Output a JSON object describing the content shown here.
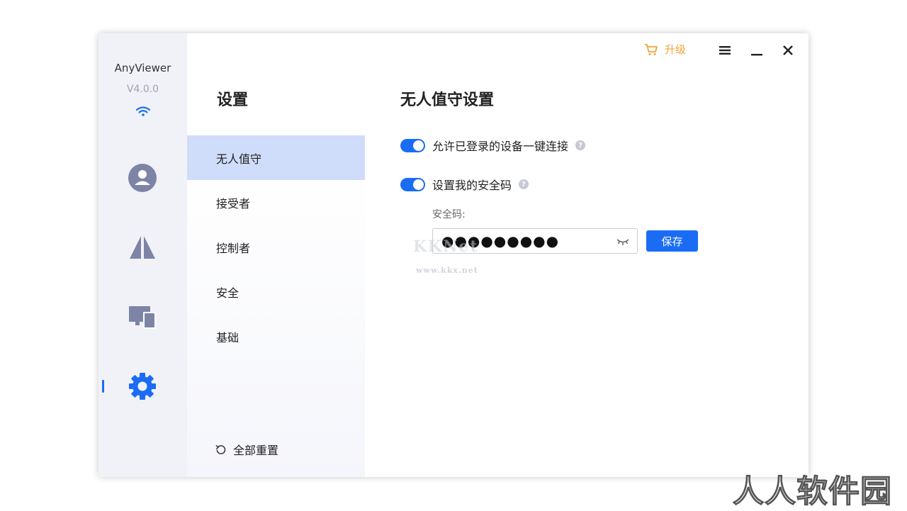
{
  "app": {
    "name": "AnyViewer",
    "version": "V4.0.0"
  },
  "rail": {
    "items": [
      {
        "icon": "account-icon"
      },
      {
        "icon": "remote-control-icon"
      },
      {
        "icon": "devices-icon"
      },
      {
        "icon": "settings-gear-icon",
        "active": true
      }
    ]
  },
  "nav": {
    "title": "设置",
    "items": [
      {
        "label": "无人值守",
        "active": true
      },
      {
        "label": "接受者"
      },
      {
        "label": "控制者"
      },
      {
        "label": "安全"
      },
      {
        "label": "基础"
      }
    ],
    "reset_label": "全部重置"
  },
  "topbar": {
    "upgrade_label": "升级"
  },
  "main": {
    "title": "无人值守设置",
    "toggle1_label": "允许已登录的设备一键连接",
    "toggle1_on": true,
    "toggle2_label": "设置我的安全码",
    "toggle2_on": true,
    "code_label": "安全码:",
    "code_value": "●●●●●●●●●",
    "save_label": "保存"
  },
  "watermarks": {
    "kk": "KKNet",
    "url": "www.kkx.net",
    "corner": "人人软件园"
  },
  "colors": {
    "accent": "#1a6cf5",
    "upgrade": "#f2a33a",
    "rail_icon": "#7d84a6",
    "nav_active": "#cfdcfa"
  }
}
